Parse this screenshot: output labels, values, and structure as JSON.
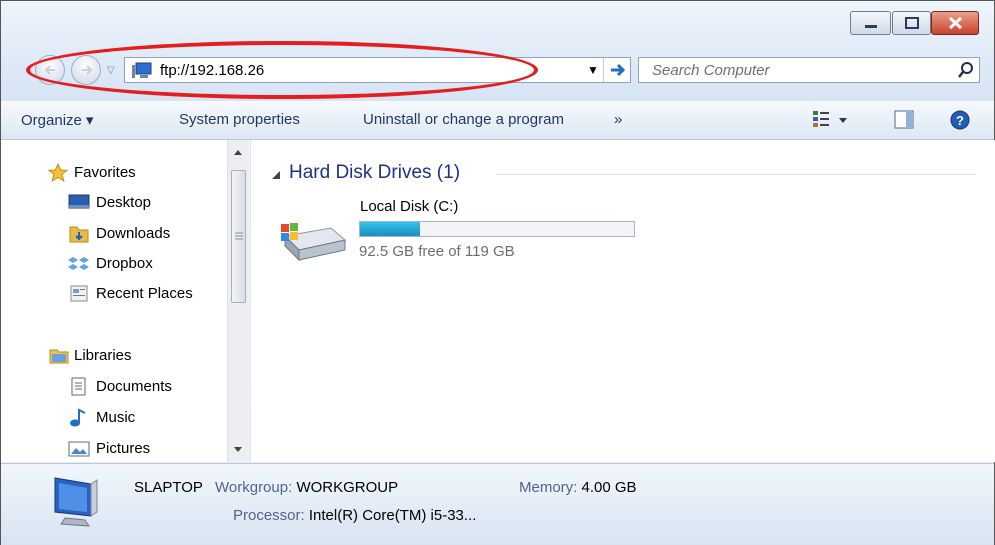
{
  "window": {
    "address": "ftp://192.168.26",
    "search_placeholder": "Search Computer"
  },
  "toolbar": {
    "organize": "Organize ▾",
    "system_properties": "System properties",
    "uninstall": "Uninstall or change a program",
    "more": "»"
  },
  "sidebar": {
    "favorites": "Favorites",
    "desktop": "Desktop",
    "downloads": "Downloads",
    "dropbox": "Dropbox",
    "recent": "Recent Places",
    "libraries": "Libraries",
    "documents": "Documents",
    "music": "Music",
    "pictures": "Pictures"
  },
  "content": {
    "group": "Hard Disk Drives (1)",
    "drive_name": "Local Disk (C:)",
    "drive_free": "92.5 GB free of 119 GB",
    "used_fraction": 0.22
  },
  "details": {
    "computer_name": "SLAPTOP",
    "workgroup_label": "Workgroup:",
    "workgroup": "WORKGROUP",
    "memory_label": "Memory:",
    "memory": "4.00 GB",
    "processor_label": "Processor:",
    "processor": "Intel(R) Core(TM) i5-33..."
  }
}
